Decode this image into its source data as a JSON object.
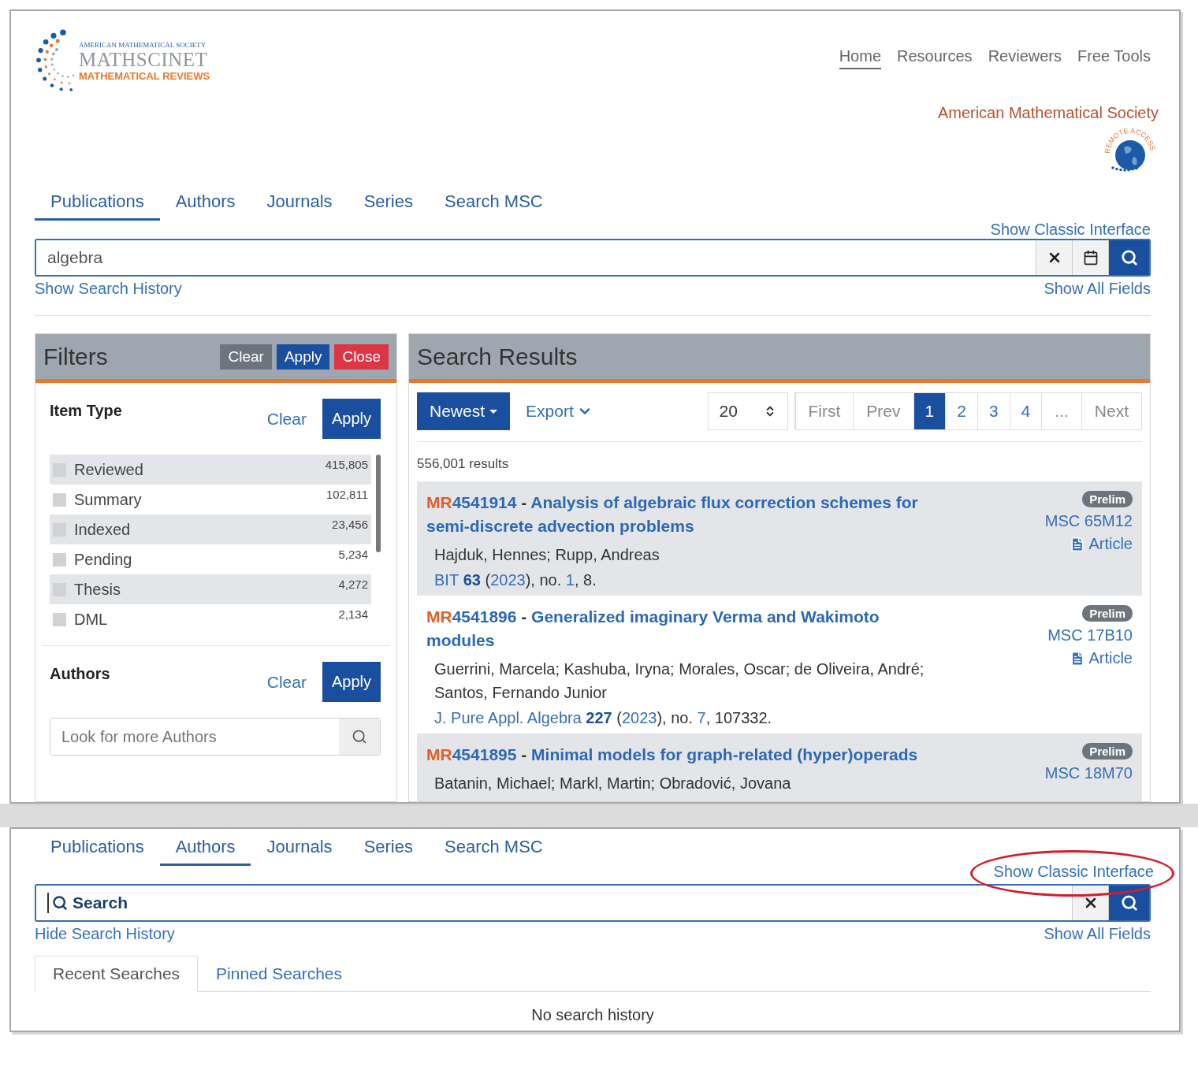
{
  "logo": {
    "society": "AMERICAN MATHEMATICAL SOCIETY",
    "product": "MATHSCINET",
    "subtitle": "MATHEMATICAL REVIEWS"
  },
  "nav": [
    {
      "label": "Home",
      "selected": true
    },
    {
      "label": "Resources",
      "selected": false
    },
    {
      "label": "Reviewers",
      "selected": false
    },
    {
      "label": "Free Tools",
      "selected": false
    }
  ],
  "society_link": "American Mathematical Society",
  "remote_badge": "REMOTE ACCESS",
  "tabs": [
    {
      "label": "Publications",
      "selected": true
    },
    {
      "label": "Authors",
      "selected": false
    },
    {
      "label": "Journals",
      "selected": false
    },
    {
      "label": "Series",
      "selected": false
    },
    {
      "label": "Search MSC",
      "selected": false
    }
  ],
  "classic_link": "Show Classic Interface",
  "search": {
    "value": "algebra"
  },
  "history_link": "Show Search History",
  "fields_link": "Show All Fields",
  "filters": {
    "title": "Filters",
    "buttons": [
      {
        "label": "Clear",
        "kind": "secondary"
      },
      {
        "label": "Apply",
        "kind": "primary"
      },
      {
        "label": "Close",
        "kind": "danger"
      }
    ],
    "item_type": {
      "title": "Item Type",
      "clear": "Clear",
      "apply": "Apply",
      "items": [
        {
          "label": "Reviewed",
          "count": "415,805",
          "checked": false
        },
        {
          "label": "Summary",
          "count": "102,811",
          "checked": false
        },
        {
          "label": "Indexed",
          "count": "23,456",
          "checked": false
        },
        {
          "label": "Pending",
          "count": "5,234",
          "checked": false
        },
        {
          "label": "Thesis",
          "count": "4,272",
          "checked": false
        },
        {
          "label": "DML",
          "count": "2,134",
          "checked": false
        }
      ]
    },
    "authors": {
      "title": "Authors",
      "clear": "Clear",
      "apply": "Apply",
      "placeholder": "Look for more Authors"
    }
  },
  "results": {
    "title": "Search Results",
    "sort": "Newest",
    "export": "Export",
    "page_size": "20",
    "pages": [
      {
        "label": "First",
        "selected": false
      },
      {
        "label": "Prev",
        "selected": false
      },
      {
        "label": "1",
        "selected": true
      },
      {
        "label": "2",
        "selected": false
      },
      {
        "label": "3",
        "selected": false
      },
      {
        "label": "4",
        "selected": false
      },
      {
        "label": "...",
        "selected": false
      },
      {
        "label": "Next",
        "selected": false
      }
    ],
    "count": "556,001 results",
    "items": [
      {
        "prefix": "MR",
        "number": "4541914",
        "separator": " - ",
        "title": "Analysis of algebraic flux correction schemes for semi-discrete advection problems",
        "badge": "Prelim",
        "msc": "MSC 65M12",
        "doc": "Article",
        "authors": "Hajduk, Hennes; Rupp, Andreas",
        "citation": [
          {
            "kind": "link",
            "text": "BIT"
          },
          {
            "kind": "bold",
            "text": " 63"
          },
          {
            "kind": "plain",
            "text": " ("
          },
          {
            "kind": "link",
            "text": "2023"
          },
          {
            "kind": "plain",
            "text": "), no. "
          },
          {
            "kind": "link",
            "text": "1"
          },
          {
            "kind": "plain",
            "text": ", 8."
          }
        ]
      },
      {
        "prefix": "MR",
        "number": "4541896",
        "separator": " - ",
        "title": "Generalized imaginary Verma and Wakimoto modules",
        "badge": "Prelim",
        "msc": "MSC 17B10",
        "doc": "Article",
        "authors": "Guerrini, Marcela; Kashuba, Iryna; Morales, Oscar; de Oliveira, André; Santos, Fernando Junior",
        "citation": [
          {
            "kind": "link",
            "text": "J. Pure Appl. Algebra"
          },
          {
            "kind": "bold",
            "text": " 227"
          },
          {
            "kind": "plain",
            "text": " ("
          },
          {
            "kind": "link",
            "text": "2023"
          },
          {
            "kind": "plain",
            "text": "), no. "
          },
          {
            "kind": "link",
            "text": "7"
          },
          {
            "kind": "plain",
            "text": ", 107332."
          }
        ]
      },
      {
        "prefix": "MR",
        "number": "4541895",
        "separator": " - ",
        "title": "Minimal models for graph-related (hyper)operads",
        "badge": "Prelim",
        "msc": "MSC 18M70",
        "authors": "Batanin, Michael; Markl, Martin; Obradović, Jovana"
      }
    ]
  },
  "second_view": {
    "tabs": [
      {
        "label": "Publications",
        "selected": false
      },
      {
        "label": "Authors",
        "selected": true
      },
      {
        "label": "Journals",
        "selected": false
      },
      {
        "label": "Series",
        "selected": false
      },
      {
        "label": "Search MSC",
        "selected": false
      }
    ],
    "classic_link": "Show Classic Interface",
    "classic_highlighted": true,
    "search": {
      "placeholder": "Search"
    },
    "history_link": "Hide Search History",
    "fields_link": "Show All Fields",
    "history_tabs": [
      {
        "label": "Recent Searches",
        "selected": true
      },
      {
        "label": "Pinned Searches",
        "selected": false
      }
    ],
    "empty": "No search history"
  }
}
